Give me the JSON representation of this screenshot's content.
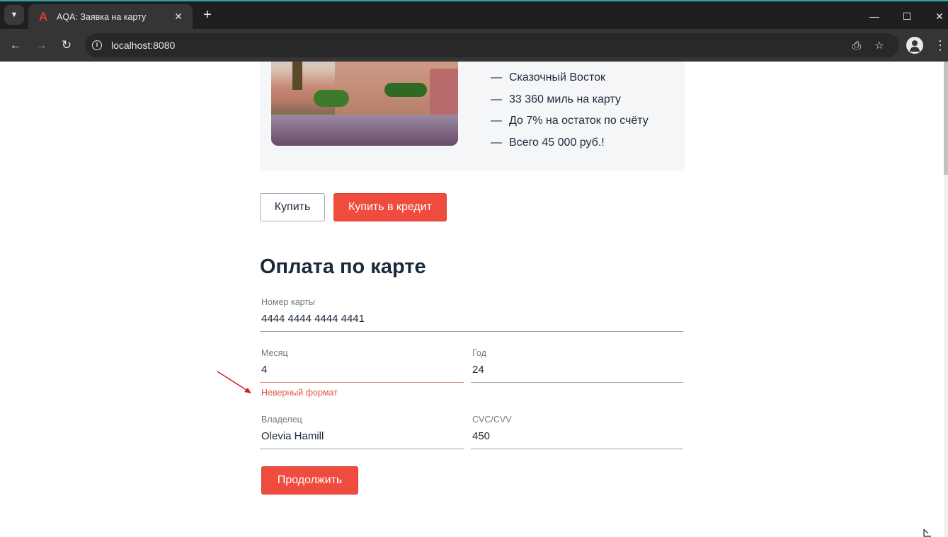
{
  "browser": {
    "tab_title": "AQA: Заявка на карту",
    "favicon": "А",
    "url": "localhost:8080",
    "new_tab_symbol": "+",
    "close_symbol": "✕"
  },
  "offer": {
    "features": [
      "Сказочный Восток",
      "33 360 миль на карту",
      "До 7% на остаток по счёту",
      "Всего 45 000 руб.!"
    ],
    "dash": "—"
  },
  "actions": {
    "buy_label": "Купить",
    "buy_credit_label": "Купить в кредит"
  },
  "payment_form": {
    "title": "Оплата по карте",
    "card_number": {
      "label": "Номер карты",
      "value": "4444 4444 4444 4441"
    },
    "month": {
      "label": "Месяц",
      "value": "4",
      "error": "Неверный формат"
    },
    "year": {
      "label": "Год",
      "value": "24"
    },
    "owner": {
      "label": "Владелец",
      "value": "Olevia Hamill"
    },
    "cvc": {
      "label": "CVC/CVV",
      "value": "450"
    },
    "continue_label": "Продолжить"
  },
  "colors": {
    "accent_red": "#ef4b3f",
    "error_text": "#e0554a",
    "text_dark": "#1b2a3b"
  }
}
